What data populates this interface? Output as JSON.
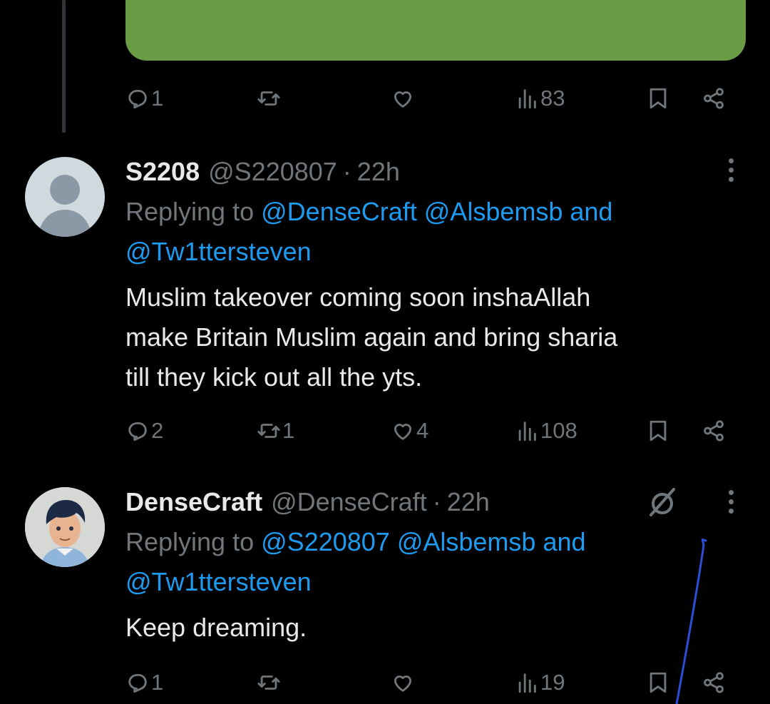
{
  "top_post": {
    "actions": {
      "replies": "1",
      "reposts": "",
      "likes": "",
      "views": "83"
    }
  },
  "tweets": [
    {
      "display_name": "S2208",
      "handle": "@S220807",
      "dot": "·",
      "time": "22h",
      "replying_prefix": "Replying to",
      "mention_1": "@DenseCraft",
      "mention_2": "@Alsbemsb",
      "and_word": "and",
      "mention_3": "@Tw1ttersteven",
      "text_line_1": "Muslim takeover coming soon inshaAllah",
      "text_line_2": "make Britain Muslim again and bring sharia",
      "text_line_3": "till they kick out all the yts.",
      "actions": {
        "replies": "2",
        "reposts": "1",
        "likes": "4",
        "views": "108"
      }
    },
    {
      "display_name": "DenseCraft",
      "handle": "@DenseCraft",
      "dot": "·",
      "time": "22h",
      "replying_prefix": "Replying to",
      "mention_1": "@S220807",
      "mention_2": "@Alsbemsb",
      "and_word": "and",
      "mention_3": "@Tw1ttersteven",
      "text_line_1": "Keep dreaming.",
      "actions": {
        "replies": "1",
        "reposts": "",
        "likes": "",
        "views": "19"
      }
    }
  ],
  "icons": [
    "reply-icon",
    "repost-icon",
    "like-icon",
    "views-icon",
    "bookmark-icon",
    "share-icon",
    "more-icon",
    "grok-icon",
    "avatar-default-icon"
  ],
  "colors": {
    "background": "#000000",
    "accent": "#1d9bf0",
    "muted": "#71767b",
    "card": "#6a9c46",
    "annotation": "#2a4fd6"
  }
}
